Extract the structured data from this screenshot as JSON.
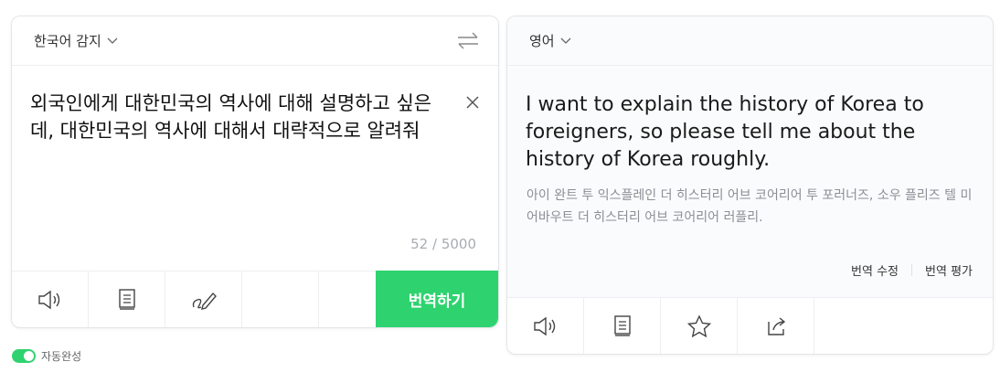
{
  "source": {
    "language": "한국어 감지",
    "text": "외국인에게 대한민국의 역사에 대해 설명하고 싶은데, 대한민국의 역사에 대해서 대략적으로 알려줘",
    "counter": "52 / 5000",
    "translate_label": "번역하기"
  },
  "target": {
    "language": "영어",
    "text": "I want to explain the history of Korea to foreigners, so please tell me about the history of Korea roughly.",
    "pronunciation": "아이 완트 투 익스플레인 더 히스터리 어브 코어리어 투 포러너즈, 소우 플리즈 텔 미 어바우트 더 히스터리 어브 코어리어 러플리.",
    "edit_label": "번역 수정",
    "rate_label": "번역 평가"
  },
  "autocomplete_label": "자동완성",
  "colors": {
    "accent": "#2ed36f",
    "border": "#e3e5e8"
  },
  "icons": [
    "chevron-down-icon",
    "swap-icon",
    "close-icon",
    "speaker-icon",
    "copy-icon",
    "handwrite-icon",
    "star-icon",
    "share-icon"
  ]
}
